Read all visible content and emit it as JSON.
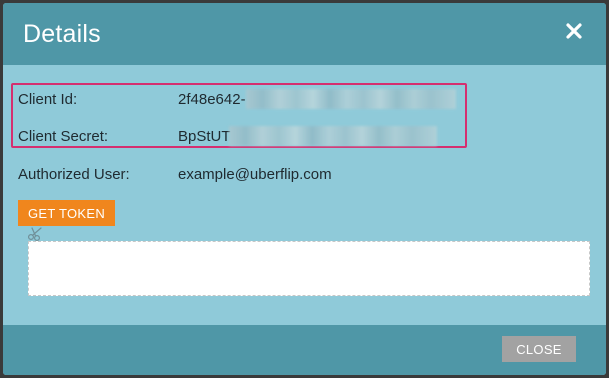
{
  "dialog": {
    "title": "Details",
    "close_icon": "close-icon"
  },
  "fields": {
    "client_id": {
      "label": "Client Id:",
      "value_visible": "2f48e642-"
    },
    "client_secret": {
      "label": "Client Secret:",
      "value_visible": "BpStUT"
    },
    "authorized_user": {
      "label": "Authorized User:",
      "value": "example@uberflip.com"
    }
  },
  "actions": {
    "get_token_label": "GET TOKEN",
    "close_label": "CLOSE"
  },
  "token_output": {
    "value": "",
    "icon": "scissors-icon"
  },
  "colors": {
    "header": "#4f97a7",
    "body": "#8fcad9",
    "highlight": "#d52e6f",
    "primary_button": "#f0861d",
    "secondary_button": "#a2a2a2"
  }
}
